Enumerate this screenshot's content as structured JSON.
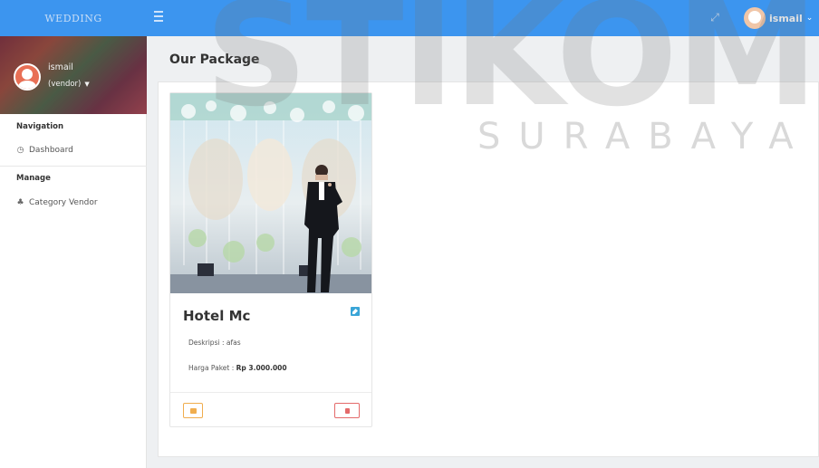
{
  "header": {
    "brand_logo": "WEDDING",
    "user_name": "ismail"
  },
  "sidebar": {
    "profile_name": "ismail",
    "profile_role": "(vendor)",
    "sections": [
      {
        "heading": "Navigation",
        "items": [
          {
            "label": "Dashboard",
            "icon": "clock-icon"
          }
        ]
      },
      {
        "heading": "Manage",
        "items": [
          {
            "label": "Category Vendor",
            "icon": "cake-icon"
          }
        ]
      }
    ]
  },
  "main": {
    "page_title": "Our Package",
    "card": {
      "title": "Hotel Mc",
      "desc_label": "Deskripsi : ",
      "desc_value": "afas",
      "price_label": "Harga Paket : ",
      "price_value": "Rp 3.000.000"
    }
  },
  "watermark": {
    "big": "STIKOM",
    "small": "SURABAYA"
  },
  "colors": {
    "topbar": "#3c95ef",
    "edit": "#f0ad4e",
    "delete": "#e46a6a",
    "info": "#3aa5d7"
  }
}
